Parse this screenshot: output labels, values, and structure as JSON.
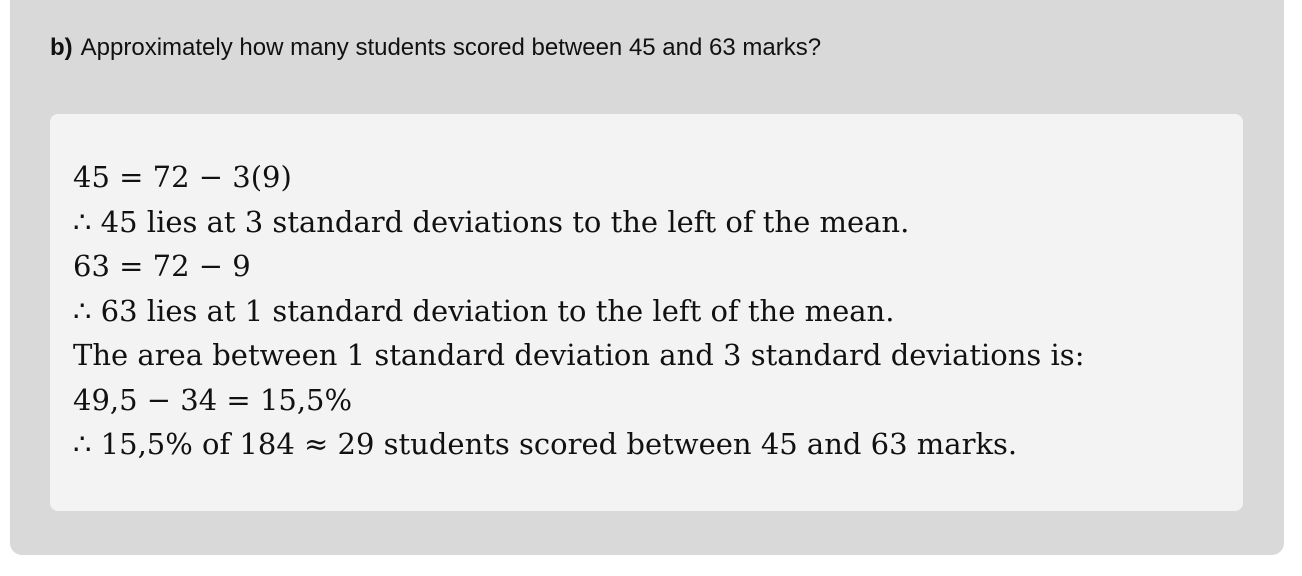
{
  "question": {
    "label": "b)",
    "text": "Approximately how many students scored between 45 and 63 marks?"
  },
  "solution": {
    "lines": [
      "45 = 72 − 3(9)",
      " ∴ 45 lies at 3 standard deviations to the left of the mean.",
      "63 = 72 − 9",
      " ∴ 63 lies at 1 standard deviation to the left of the mean.",
      "The area between 1 standard deviation and 3 standard deviations is:",
      "49,5 − 34 = 15,5%",
      " ∴ 15,5% of 184 ≈ 29 students scored between 45 and 63 marks."
    ]
  }
}
